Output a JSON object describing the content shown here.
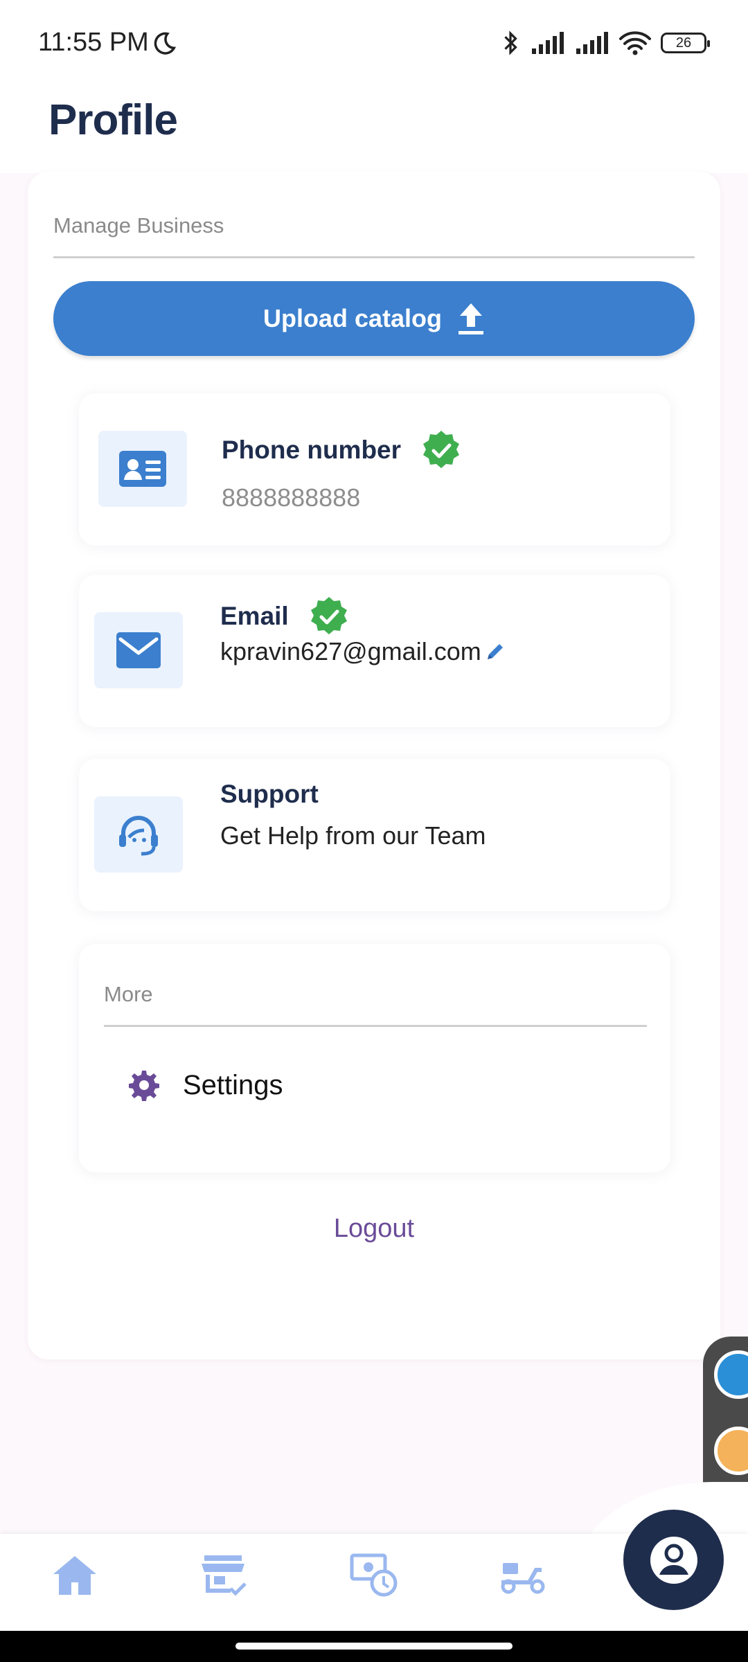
{
  "status_bar": {
    "time": "11:55 PM",
    "battery": "26"
  },
  "header": {
    "title": "Profile"
  },
  "manage_business": {
    "label": "Manage Business",
    "upload_button_label": "Upload catalog"
  },
  "phone": {
    "title": "Phone number",
    "value": "8888888888"
  },
  "email": {
    "title": "Email",
    "value": "kpravin627@gmail.com"
  },
  "support": {
    "title": "Support",
    "subtitle": "Get Help from our Team"
  },
  "more": {
    "label": "More",
    "settings_label": "Settings"
  },
  "logout_label": "Logout",
  "colors": {
    "primary": "#3b7fce",
    "verified": "#3fae4f",
    "logout": "#6a4b98",
    "navy": "#1f2d4d",
    "nav_icon": "#9ab8ef"
  },
  "icons": {
    "nav": [
      "home-icon",
      "store-check-icon",
      "payment-clock-icon",
      "delivery-scooter-icon",
      "profile-icon"
    ]
  }
}
